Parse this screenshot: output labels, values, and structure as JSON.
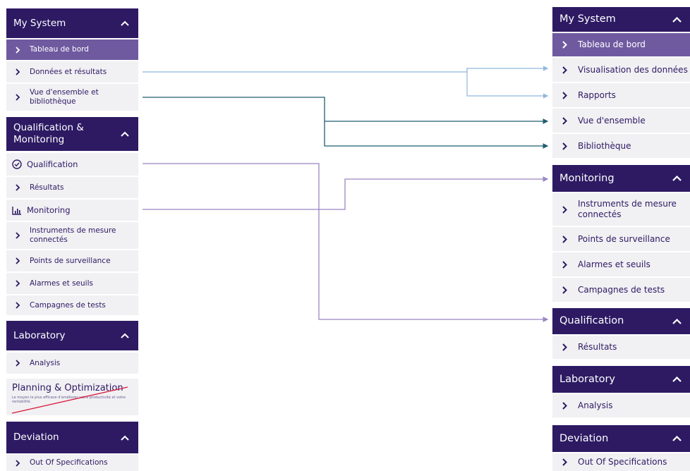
{
  "colors": {
    "header": "#2d1a63",
    "selected": "#6f5aa0",
    "item_bg": "#f1f0f3",
    "link_light": "#8fb8df",
    "link_dark": "#1f5f6f",
    "link_purple": "#9b85c1",
    "strike": "#d81b3a"
  },
  "left": {
    "my_system": {
      "title": "My System",
      "items": [
        "Tableau de bord",
        "Données et résultats",
        "Vue d'ensemble et bibliothèque"
      ]
    },
    "qualification_monitoring": {
      "title": "Qualification & Monitoring",
      "qualification": "Qualification",
      "resultats": "Résultats",
      "monitoring": "Monitoring",
      "items": [
        "Instruments de mesure connectés",
        "Points de surveillance",
        "Alarmes et seuils",
        "Campagnes de tests"
      ]
    },
    "laboratory": {
      "title": "Laboratory",
      "items": [
        "Analysis"
      ]
    },
    "planning": {
      "title": "Planning & Optimization",
      "desc": "Le moyen le plus efficace d'améliorer votre productivité et votre rentabilité."
    },
    "deviation": {
      "title": "Deviation",
      "items": [
        "Out Of Specifications"
      ]
    }
  },
  "right": {
    "my_system": {
      "title": "My System",
      "items": [
        "Tableau de bord",
        "Visualisation des données",
        "Rapports",
        "Vue d'ensemble",
        "Bibliothèque"
      ]
    },
    "monitoring": {
      "title": "Monitoring",
      "items": [
        "Instruments de mesure connectés",
        "Points de surveillance",
        "Alarmes et seuils",
        "Campagnes de tests"
      ]
    },
    "qualification": {
      "title": "Qualification",
      "items": [
        "Résultats"
      ]
    },
    "laboratory": {
      "title": "Laboratory",
      "items": [
        "Analysis"
      ]
    },
    "deviation": {
      "title": "Deviation",
      "items": [
        "Out Of Specifications"
      ]
    }
  }
}
